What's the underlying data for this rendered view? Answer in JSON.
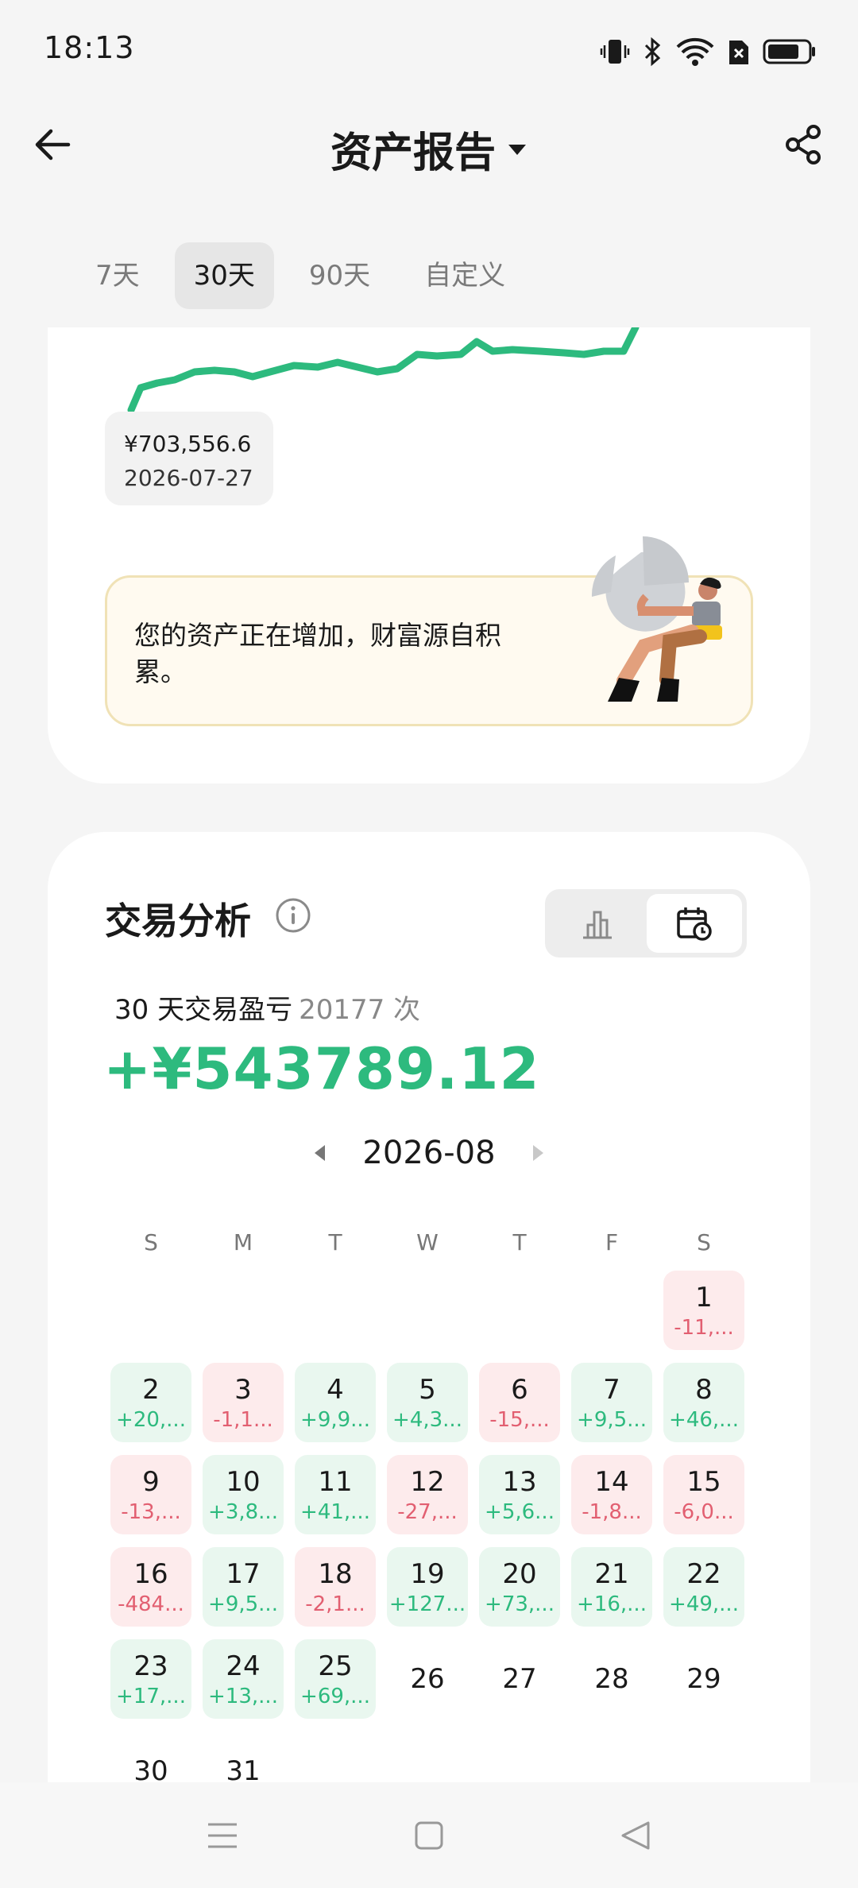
{
  "status_bar": {
    "time": "18:13",
    "icons": [
      "vibrate-icon",
      "bluetooth-icon",
      "wifi-icon",
      "sim-off-icon",
      "battery-icon"
    ]
  },
  "header": {
    "title": "资产报告",
    "back_icon": "back-arrow-icon",
    "dropdown_icon": "caret-down-icon",
    "share_icon": "share-icon"
  },
  "period_tabs": [
    {
      "label": "7天",
      "active": false
    },
    {
      "label": "30天",
      "active": true
    },
    {
      "label": "90天",
      "active": false
    },
    {
      "label": "自定义",
      "active": false
    }
  ],
  "asset_card": {
    "tooltip_value": "¥703,556.6",
    "tooltip_date": "2026-07-27",
    "tip_text": "您的资产正在增加，财富源自积累。",
    "line_color": "#2dba7e"
  },
  "trade_card": {
    "title": "交易分析",
    "info_icon": "info-icon",
    "toggle_icons": [
      "bar-chart-icon",
      "calendar-icon"
    ],
    "summary_label": "30 天交易盈亏",
    "summary_count": "20177 次",
    "summary_value": "+¥543789.12",
    "month": "2026-08",
    "weekdays": [
      "S",
      "M",
      "T",
      "W",
      "T",
      "F",
      "S"
    ],
    "profit_color": "#2dba7e",
    "loss_color": "#e25f71",
    "days": [
      {
        "day": "1",
        "pnl": "-11,...",
        "type": "loss"
      },
      {
        "day": "2",
        "pnl": "+20,...",
        "type": "profit"
      },
      {
        "day": "3",
        "pnl": "-1,1...",
        "type": "loss"
      },
      {
        "day": "4",
        "pnl": "+9,9...",
        "type": "profit"
      },
      {
        "day": "5",
        "pnl": "+4,3...",
        "type": "profit"
      },
      {
        "day": "6",
        "pnl": "-15,...",
        "type": "loss"
      },
      {
        "day": "7",
        "pnl": "+9,5...",
        "type": "profit"
      },
      {
        "day": "8",
        "pnl": "+46,...",
        "type": "profit"
      },
      {
        "day": "9",
        "pnl": "-13,...",
        "type": "loss"
      },
      {
        "day": "10",
        "pnl": "+3,8...",
        "type": "profit"
      },
      {
        "day": "11",
        "pnl": "+41,...",
        "type": "profit"
      },
      {
        "day": "12",
        "pnl": "-27,...",
        "type": "loss"
      },
      {
        "day": "13",
        "pnl": "+5,6...",
        "type": "profit"
      },
      {
        "day": "14",
        "pnl": "-1,8...",
        "type": "loss"
      },
      {
        "day": "15",
        "pnl": "-6,0...",
        "type": "loss"
      },
      {
        "day": "16",
        "pnl": "-484...",
        "type": "loss"
      },
      {
        "day": "17",
        "pnl": "+9,5...",
        "type": "profit"
      },
      {
        "day": "18",
        "pnl": "-2,1...",
        "type": "loss"
      },
      {
        "day": "19",
        "pnl": "+127...",
        "type": "profit"
      },
      {
        "day": "20",
        "pnl": "+73,...",
        "type": "profit"
      },
      {
        "day": "21",
        "pnl": "+16,...",
        "type": "profit"
      },
      {
        "day": "22",
        "pnl": "+49,...",
        "type": "profit"
      },
      {
        "day": "23",
        "pnl": "+17,...",
        "type": "profit"
      },
      {
        "day": "24",
        "pnl": "+13,...",
        "type": "profit"
      },
      {
        "day": "25",
        "pnl": "+69,...",
        "type": "profit"
      },
      {
        "day": "26",
        "pnl": "",
        "type": "plain"
      },
      {
        "day": "27",
        "pnl": "",
        "type": "plain"
      },
      {
        "day": "28",
        "pnl": "",
        "type": "plain"
      },
      {
        "day": "29",
        "pnl": "",
        "type": "plain"
      },
      {
        "day": "30",
        "pnl": "",
        "type": "plain"
      },
      {
        "day": "31",
        "pnl": "",
        "type": "plain"
      }
    ]
  },
  "system_nav": [
    "menu-icon",
    "home-square-icon",
    "back-triangle-icon"
  ]
}
